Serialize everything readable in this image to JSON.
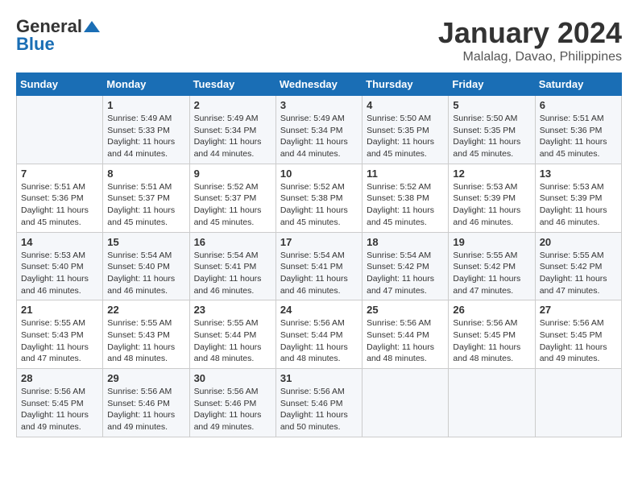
{
  "header": {
    "logo_general": "General",
    "logo_blue": "Blue",
    "title": "January 2024",
    "subtitle": "Malalag, Davao, Philippines"
  },
  "columns": [
    "Sunday",
    "Monday",
    "Tuesday",
    "Wednesday",
    "Thursday",
    "Friday",
    "Saturday"
  ],
  "weeks": [
    [
      {
        "day": "",
        "sunrise": "",
        "sunset": "",
        "daylight": ""
      },
      {
        "day": "1",
        "sunrise": "5:49 AM",
        "sunset": "5:33 PM",
        "daylight": "11 hours and 44 minutes."
      },
      {
        "day": "2",
        "sunrise": "5:49 AM",
        "sunset": "5:34 PM",
        "daylight": "11 hours and 44 minutes."
      },
      {
        "day": "3",
        "sunrise": "5:49 AM",
        "sunset": "5:34 PM",
        "daylight": "11 hours and 44 minutes."
      },
      {
        "day": "4",
        "sunrise": "5:50 AM",
        "sunset": "5:35 PM",
        "daylight": "11 hours and 45 minutes."
      },
      {
        "day": "5",
        "sunrise": "5:50 AM",
        "sunset": "5:35 PM",
        "daylight": "11 hours and 45 minutes."
      },
      {
        "day": "6",
        "sunrise": "5:51 AM",
        "sunset": "5:36 PM",
        "daylight": "11 hours and 45 minutes."
      }
    ],
    [
      {
        "day": "7",
        "sunrise": "5:51 AM",
        "sunset": "5:36 PM",
        "daylight": "11 hours and 45 minutes."
      },
      {
        "day": "8",
        "sunrise": "5:51 AM",
        "sunset": "5:37 PM",
        "daylight": "11 hours and 45 minutes."
      },
      {
        "day": "9",
        "sunrise": "5:52 AM",
        "sunset": "5:37 PM",
        "daylight": "11 hours and 45 minutes."
      },
      {
        "day": "10",
        "sunrise": "5:52 AM",
        "sunset": "5:38 PM",
        "daylight": "11 hours and 45 minutes."
      },
      {
        "day": "11",
        "sunrise": "5:52 AM",
        "sunset": "5:38 PM",
        "daylight": "11 hours and 45 minutes."
      },
      {
        "day": "12",
        "sunrise": "5:53 AM",
        "sunset": "5:39 PM",
        "daylight": "11 hours and 46 minutes."
      },
      {
        "day": "13",
        "sunrise": "5:53 AM",
        "sunset": "5:39 PM",
        "daylight": "11 hours and 46 minutes."
      }
    ],
    [
      {
        "day": "14",
        "sunrise": "5:53 AM",
        "sunset": "5:40 PM",
        "daylight": "11 hours and 46 minutes."
      },
      {
        "day": "15",
        "sunrise": "5:54 AM",
        "sunset": "5:40 PM",
        "daylight": "11 hours and 46 minutes."
      },
      {
        "day": "16",
        "sunrise": "5:54 AM",
        "sunset": "5:41 PM",
        "daylight": "11 hours and 46 minutes."
      },
      {
        "day": "17",
        "sunrise": "5:54 AM",
        "sunset": "5:41 PM",
        "daylight": "11 hours and 46 minutes."
      },
      {
        "day": "18",
        "sunrise": "5:54 AM",
        "sunset": "5:42 PM",
        "daylight": "11 hours and 47 minutes."
      },
      {
        "day": "19",
        "sunrise": "5:55 AM",
        "sunset": "5:42 PM",
        "daylight": "11 hours and 47 minutes."
      },
      {
        "day": "20",
        "sunrise": "5:55 AM",
        "sunset": "5:42 PM",
        "daylight": "11 hours and 47 minutes."
      }
    ],
    [
      {
        "day": "21",
        "sunrise": "5:55 AM",
        "sunset": "5:43 PM",
        "daylight": "11 hours and 47 minutes."
      },
      {
        "day": "22",
        "sunrise": "5:55 AM",
        "sunset": "5:43 PM",
        "daylight": "11 hours and 48 minutes."
      },
      {
        "day": "23",
        "sunrise": "5:55 AM",
        "sunset": "5:44 PM",
        "daylight": "11 hours and 48 minutes."
      },
      {
        "day": "24",
        "sunrise": "5:56 AM",
        "sunset": "5:44 PM",
        "daylight": "11 hours and 48 minutes."
      },
      {
        "day": "25",
        "sunrise": "5:56 AM",
        "sunset": "5:44 PM",
        "daylight": "11 hours and 48 minutes."
      },
      {
        "day": "26",
        "sunrise": "5:56 AM",
        "sunset": "5:45 PM",
        "daylight": "11 hours and 48 minutes."
      },
      {
        "day": "27",
        "sunrise": "5:56 AM",
        "sunset": "5:45 PM",
        "daylight": "11 hours and 49 minutes."
      }
    ],
    [
      {
        "day": "28",
        "sunrise": "5:56 AM",
        "sunset": "5:45 PM",
        "daylight": "11 hours and 49 minutes."
      },
      {
        "day": "29",
        "sunrise": "5:56 AM",
        "sunset": "5:46 PM",
        "daylight": "11 hours and 49 minutes."
      },
      {
        "day": "30",
        "sunrise": "5:56 AM",
        "sunset": "5:46 PM",
        "daylight": "11 hours and 49 minutes."
      },
      {
        "day": "31",
        "sunrise": "5:56 AM",
        "sunset": "5:46 PM",
        "daylight": "11 hours and 50 minutes."
      },
      {
        "day": "",
        "sunrise": "",
        "sunset": "",
        "daylight": ""
      },
      {
        "day": "",
        "sunrise": "",
        "sunset": "",
        "daylight": ""
      },
      {
        "day": "",
        "sunrise": "",
        "sunset": "",
        "daylight": ""
      }
    ]
  ]
}
